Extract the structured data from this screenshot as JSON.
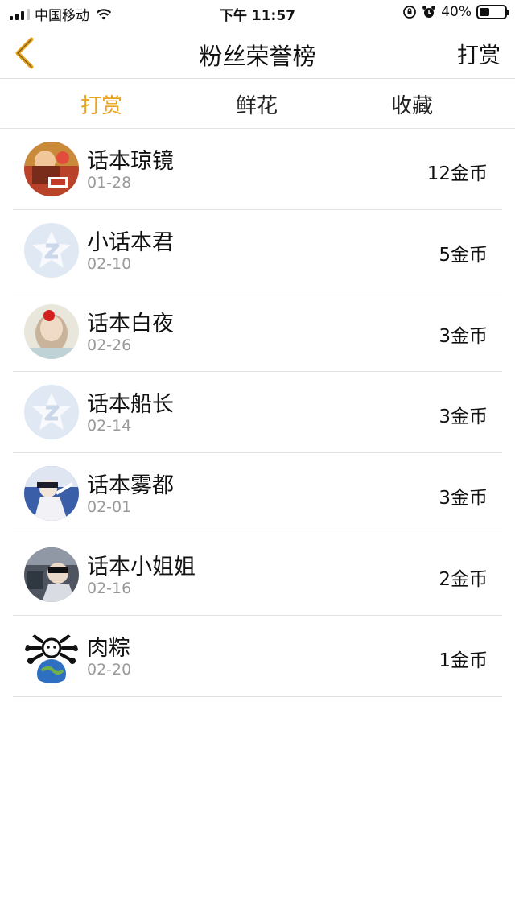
{
  "status_bar": {
    "carrier": "中国移动",
    "time": "下午 11:57",
    "battery_text": "40%",
    "battery_level": 0.4
  },
  "nav": {
    "title": "粉丝荣誉榜",
    "action": "打赏",
    "accent_color": "#e8a41e"
  },
  "tabs": [
    {
      "label": "打赏",
      "active": true
    },
    {
      "label": "鲜花",
      "active": false
    },
    {
      "label": "收藏",
      "active": false
    }
  ],
  "list": [
    {
      "name": "话本琼镜",
      "date": "01-28",
      "amount": "12金币",
      "avatar": "photo-avatar"
    },
    {
      "name": "小话本君",
      "date": "02-10",
      "amount": "5金币",
      "avatar": "default-z-avatar"
    },
    {
      "name": "话本白夜",
      "date": "02-26",
      "amount": "3金币",
      "avatar": "photo-avatar"
    },
    {
      "name": "话本船长",
      "date": "02-14",
      "amount": "3金币",
      "avatar": "default-z-avatar"
    },
    {
      "name": "话本雾都",
      "date": "02-01",
      "amount": "3金币",
      "avatar": "photo-avatar"
    },
    {
      "name": "话本小姐姐",
      "date": "02-16",
      "amount": "2金币",
      "avatar": "photo-avatar"
    },
    {
      "name": "肉粽",
      "date": "02-20",
      "amount": "1金币",
      "avatar": "photo-avatar"
    }
  ]
}
